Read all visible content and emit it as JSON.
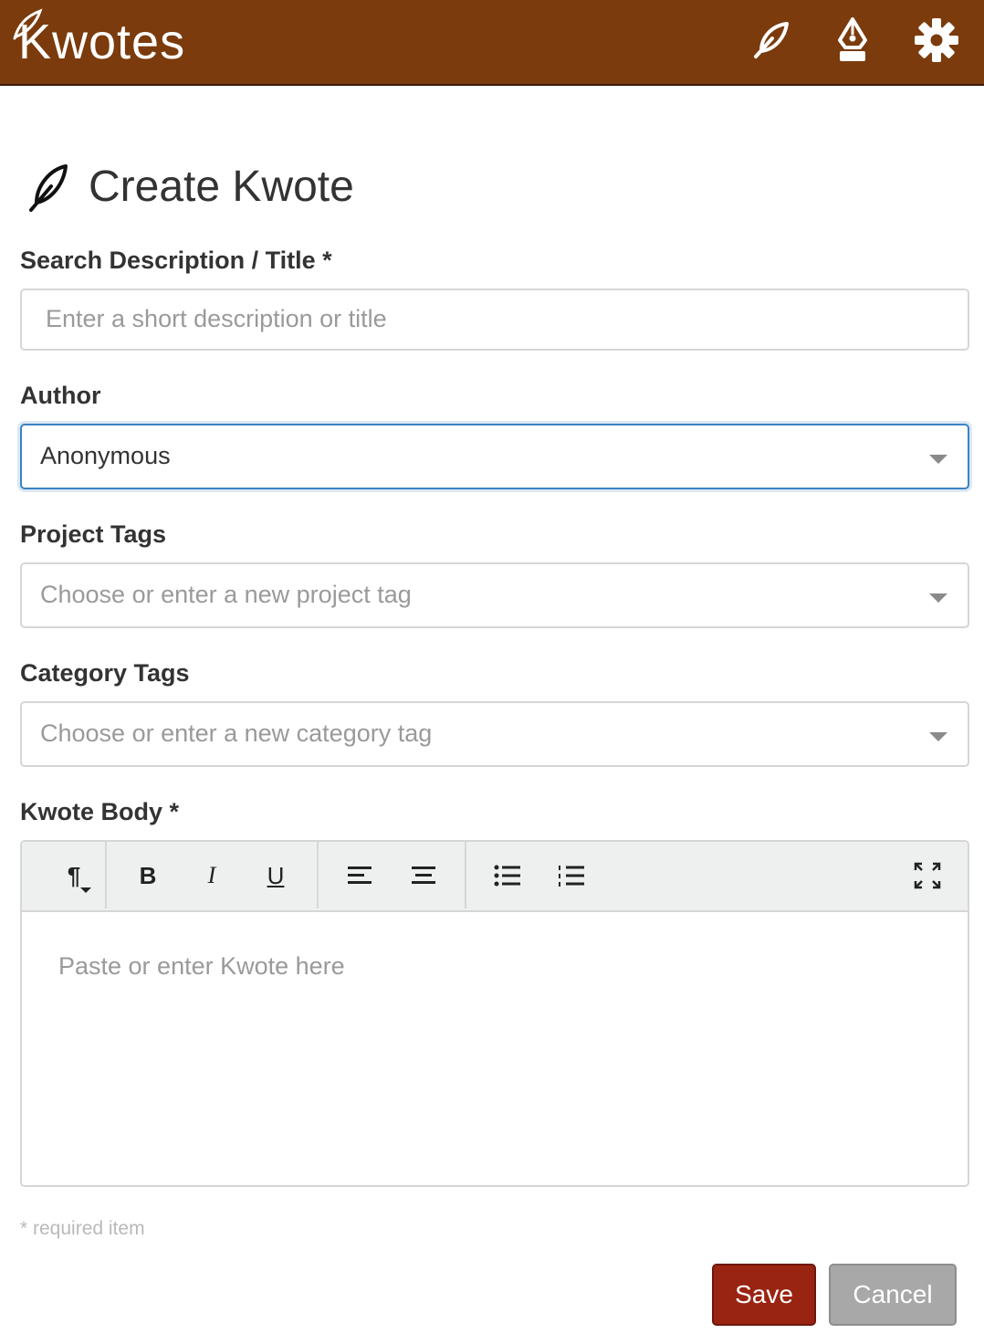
{
  "app": {
    "logo_text": "Kwotes",
    "header_icons": [
      "feather-icon",
      "pen-nib-icon",
      "gear-icon"
    ],
    "brand_color": "#7b3b0c"
  },
  "page": {
    "title": "Create Kwote",
    "title_icon": "feather-icon"
  },
  "form": {
    "description": {
      "label": "Search Description / Title *",
      "placeholder": "Enter a short description or title",
      "value": ""
    },
    "author": {
      "label": "Author",
      "value": "Anonymous"
    },
    "project_tags": {
      "label": "Project Tags",
      "placeholder": "Choose or enter a new project tag"
    },
    "category_tags": {
      "label": "Category Tags",
      "placeholder": "Choose or enter a new category tag"
    },
    "body": {
      "label": "Kwote Body *",
      "placeholder": "Paste or enter Kwote here",
      "toolbar": {
        "paragraph": "¶",
        "bold": "B",
        "italic": "I",
        "underline": "U"
      }
    },
    "required_note": "* required item"
  },
  "actions": {
    "save_label": "Save",
    "cancel_label": "Cancel",
    "save_color": "#9a2412",
    "cancel_color": "#a8a8a8"
  }
}
